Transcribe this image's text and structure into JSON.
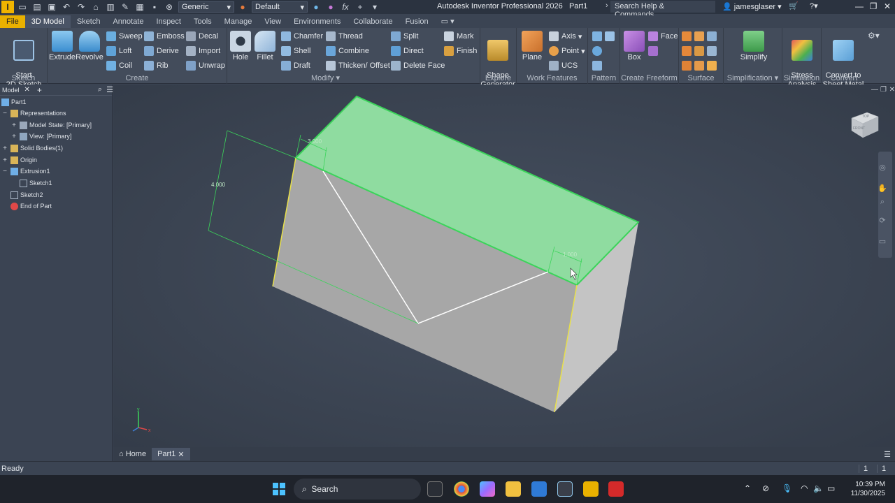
{
  "titlebar": {
    "app_logo": "I",
    "appearance": "Generic",
    "material": "Default",
    "title": "Autodesk Inventor Professional 2026",
    "doc": "Part1",
    "search_placeholder": "Search Help & Commands...",
    "user": "jamesglaser"
  },
  "tabs": [
    "File",
    "3D Model",
    "Sketch",
    "Annotate",
    "Inspect",
    "Tools",
    "Manage",
    "View",
    "Environments",
    "Collaborate",
    "Fusion"
  ],
  "ribbon": {
    "sketch": {
      "start": "Start\n2D Sketch",
      "label": "Sketch"
    },
    "create": {
      "extrude": "Extrude",
      "revolve": "Revolve",
      "sweep": "Sweep",
      "emboss": "Emboss",
      "decal": "Decal",
      "loft": "Loft",
      "derive": "Derive",
      "import": "Import",
      "coil": "Coil",
      "rib": "Rib",
      "unwrap": "Unwrap",
      "label": "Create"
    },
    "modify": {
      "hole": "Hole",
      "fillet": "Fillet",
      "chamfer": "Chamfer",
      "thread": "Thread",
      "split": "Split",
      "shell": "Shell",
      "combine": "Combine",
      "direct": "Direct",
      "draft": "Draft",
      "thicken": "Thicken/ Offset",
      "delete_face": "Delete Face",
      "label": "Modify"
    },
    "explore": {
      "mark": "Mark",
      "finish": "Finish",
      "shape_gen": "Shape\nGenerator",
      "label": "Explore"
    },
    "work": {
      "plane": "Plane",
      "axis": "Axis",
      "point": "Point",
      "ucs": "UCS",
      "label": "Work Features"
    },
    "pattern": {
      "label": "Pattern"
    },
    "freeform": {
      "box": "Box",
      "face": "Face",
      "label": "Create Freeform"
    },
    "surface": {
      "label": "Surface"
    },
    "simplification": {
      "simplify": "Simplify",
      "label": "Simplification"
    },
    "simulation": {
      "stress": "Stress\nAnalysis",
      "label": "Simulation"
    },
    "convert": {
      "sheet_metal": "Convert to\nSheet Metal",
      "label": "Convert"
    }
  },
  "browser": {
    "tab": "Model",
    "items": [
      "Part1",
      "Representations",
      "Model State: [Primary]",
      "View: [Primary]",
      "Solid Bodies(1)",
      "Origin",
      "Extrusion1",
      "Sketch1",
      "Sketch2",
      "End of Part"
    ]
  },
  "viewport": {
    "dims": [
      "3.000",
      "4.000",
      "1.000"
    ],
    "viewcube": {
      "top": "TOP",
      "front": "FRONT"
    }
  },
  "doctabs": {
    "home": "Home",
    "part": "Part1"
  },
  "status": {
    "text": "Ready",
    "count1": "1",
    "count2": "1"
  },
  "taskbar": {
    "search": "Search",
    "time": "10:39 PM",
    "date": "11/30/2025"
  }
}
